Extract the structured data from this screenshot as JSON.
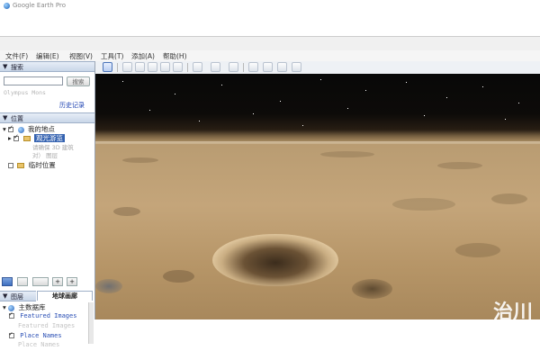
{
  "window": {
    "title": "Google Earth Pro"
  },
  "menubar": [
    {
      "label": "文件(F)"
    },
    {
      "label": "编辑(E)"
    },
    {
      "label": "视图(V)"
    },
    {
      "label": "工具(T)"
    },
    {
      "label": "添加(A)"
    },
    {
      "label": "帮助(H)"
    }
  ],
  "search": {
    "header": "搜索",
    "button": "搜索",
    "hint": "Olympus Mons",
    "history_link": "历史记录"
  },
  "places": {
    "header": "位置",
    "my_places": "我的地点",
    "sightseeing": "观光游览",
    "sub_hint_1": "请确保 3D 建筑",
    "sub_hint_2": "对） 图层",
    "temporary": "临时位置"
  },
  "layers": {
    "header": "图层",
    "tab_active": "地球画廊",
    "primary_db": "主数据库",
    "items": [
      {
        "label": "Featured Images",
        "checked": true
      },
      {
        "label": "Featured Images",
        "checked": false
      },
      {
        "label": "Place Names",
        "checked": true
      },
      {
        "label": "Place Names",
        "checked": false
      }
    ]
  },
  "viewport": {
    "scene": "mars-surface",
    "watermark": "治川"
  }
}
